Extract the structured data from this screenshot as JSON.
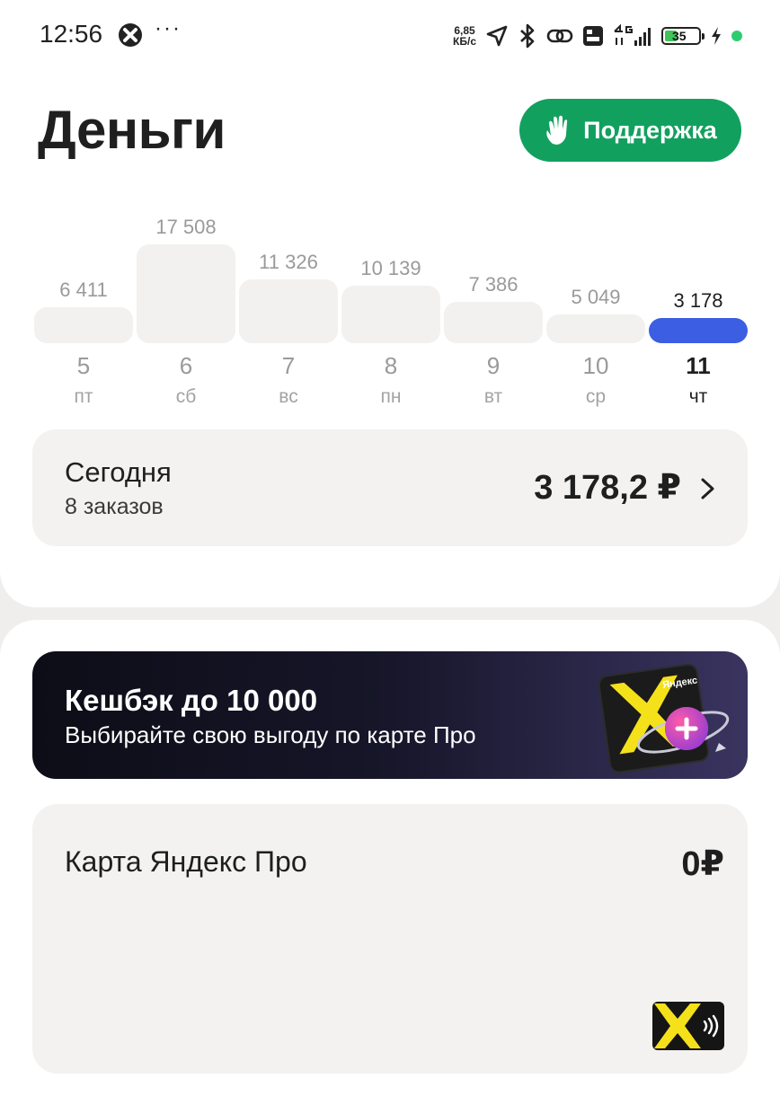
{
  "status_bar": {
    "time": "12:56",
    "dots": "···",
    "net_speed_value": "6,85",
    "net_speed_unit": "КБ/с",
    "battery": "35",
    "battery_level": 0.35
  },
  "header": {
    "title": "Деньги",
    "support_label": "Поддержка"
  },
  "chart_data": {
    "type": "bar",
    "categories": [
      "5",
      "6",
      "7",
      "8",
      "9",
      "10",
      "11"
    ],
    "weekdays": [
      "пт",
      "сб",
      "вс",
      "пн",
      "вт",
      "ср",
      "чт"
    ],
    "values": [
      6411,
      17508,
      11326,
      10139,
      7386,
      5049,
      3178
    ],
    "value_labels": [
      "6 411",
      "17 508",
      "11 326",
      "10 139",
      "7 386",
      "5 049",
      "3 178"
    ],
    "selected_index": 6,
    "colors": {
      "bar": "#f2f1f0",
      "selected": "#3b5ee3"
    }
  },
  "today": {
    "title": "Сегодня",
    "orders": "8 заказов",
    "amount": "3 178,2 ₽"
  },
  "banner": {
    "title": "Кешбэк до 10 000",
    "subtitle": "Выбирайте свою выгоду по карте Про",
    "art_brand": "Яндекс"
  },
  "card_pro": {
    "title": "Карта Яндекс Про",
    "balance": "0₽"
  },
  "colors": {
    "accent_green": "#12a05f",
    "accent_blue": "#3b5ee3",
    "card_yellow": "#f5e11a"
  }
}
